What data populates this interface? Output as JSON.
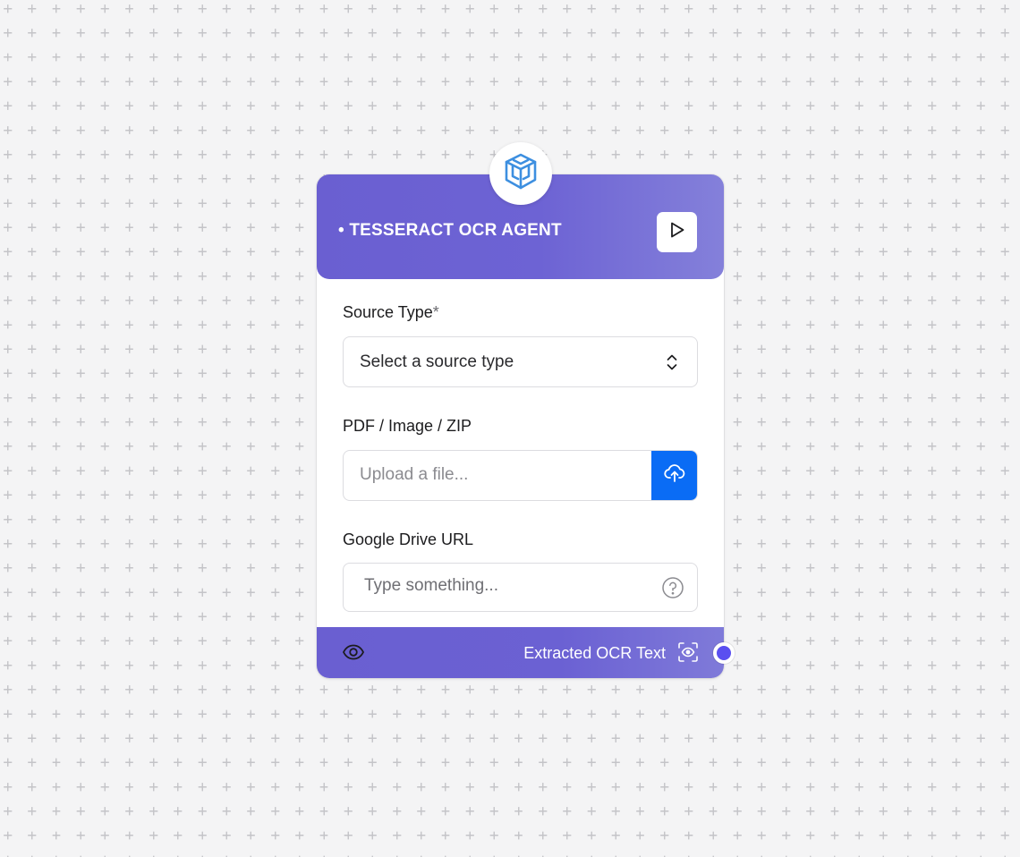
{
  "node": {
    "title": "• TESSERACT OCR AGENT",
    "logo_icon": "cube-logo-icon",
    "run_icon": "play-icon",
    "header_color": "#6a5fd1"
  },
  "fields": {
    "source_type": {
      "label": "Source Type",
      "required_mark": "*",
      "value": "Select a source type"
    },
    "file": {
      "label": "PDF / Image / ZIP",
      "placeholder": "Upload a file...",
      "upload_icon": "cloud-upload-icon",
      "button_color": "#0a6cf5"
    },
    "gdrive": {
      "label": "Google Drive URL",
      "placeholder": "Type something...",
      "help_icon": "help-circle-icon"
    }
  },
  "footer": {
    "preview_icon": "eye-icon",
    "output_label": "Extracted OCR Text",
    "output_icon": "scan-eye-icon",
    "handle_color": "#5a4ff0"
  }
}
